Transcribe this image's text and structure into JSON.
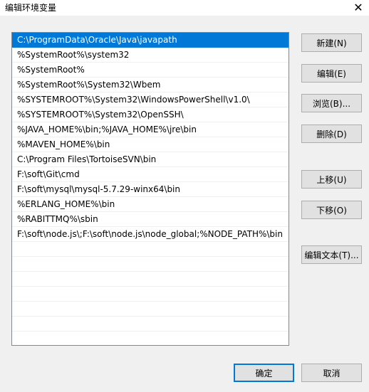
{
  "window": {
    "title": "编辑环境变量",
    "close_glyph": "✕"
  },
  "list": {
    "items": [
      "C:\\ProgramData\\Oracle\\Java\\javapath",
      "%SystemRoot%\\system32",
      "%SystemRoot%",
      "%SystemRoot%\\System32\\Wbem",
      "%SYSTEMROOT%\\System32\\WindowsPowerShell\\v1.0\\",
      "%SYSTEMROOT%\\System32\\OpenSSH\\",
      "%JAVA_HOME%\\bin;%JAVA_HOME%\\jre\\bin",
      "%MAVEN_HOME%\\bin",
      "C:\\Program Files\\TortoiseSVN\\bin",
      "F:\\soft\\Git\\cmd",
      "F:\\soft\\mysql\\mysql-5.7.29-winx64\\bin",
      "%ERLANG_HOME%\\bin",
      "%RABITTMQ%\\sbin",
      "F:\\soft\\node.js\\;F:\\soft\\node.js\\node_global;%NODE_PATH%\\bin"
    ],
    "selected_index": 0
  },
  "buttons": {
    "new": "新建(N)",
    "edit": "编辑(E)",
    "browse": "浏览(B)...",
    "delete": "删除(D)",
    "move_up": "上移(U)",
    "move_down": "下移(O)",
    "edit_text": "编辑文本(T)...",
    "ok": "确定",
    "cancel": "取消"
  },
  "colors": {
    "selection": "#0078d7",
    "default_button_border": "#0078d7"
  }
}
